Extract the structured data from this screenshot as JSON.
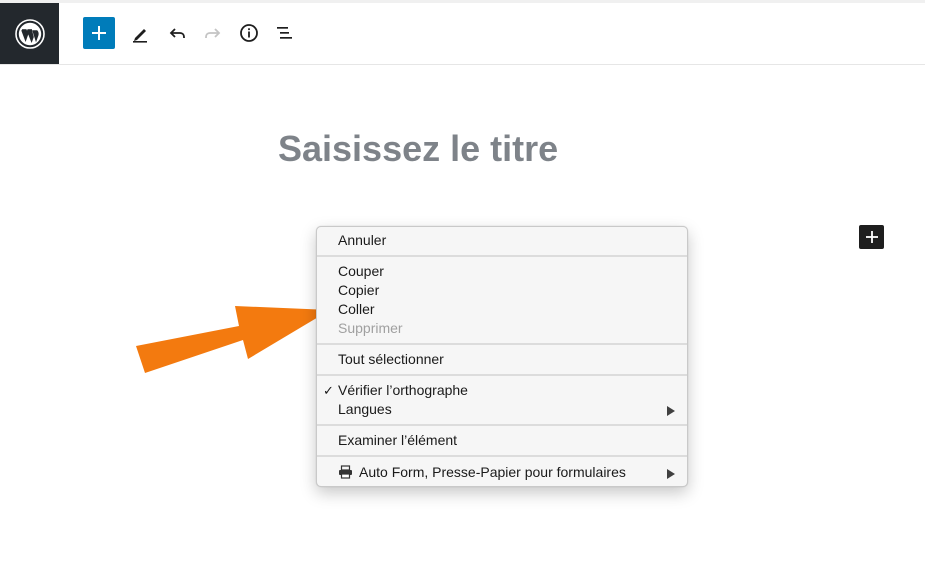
{
  "toolbar": {
    "logo": "wordpress-logo",
    "buttons": [
      "add-block",
      "tools-pencil",
      "undo",
      "redo",
      "info",
      "list-view"
    ]
  },
  "editor": {
    "title_placeholder": "Saisissez le titre"
  },
  "context_menu": {
    "items": {
      "annuler": "Annuler",
      "couper": "Couper",
      "copier": "Copier",
      "coller": "Coller",
      "supprimer": "Supprimer",
      "tout_selectionner": "Tout sélectionner",
      "verifier": "Vérifier l’orthographe",
      "langues": "Langues",
      "examiner": "Examiner l’élément",
      "autoform": "Auto Form, Presse-Papier pour formulaires"
    },
    "checkmark": "✓"
  },
  "colors": {
    "accent": "#007cba",
    "wp_dark": "#23282d",
    "arrow": "#f37a0f",
    "title": "#7e8389"
  }
}
